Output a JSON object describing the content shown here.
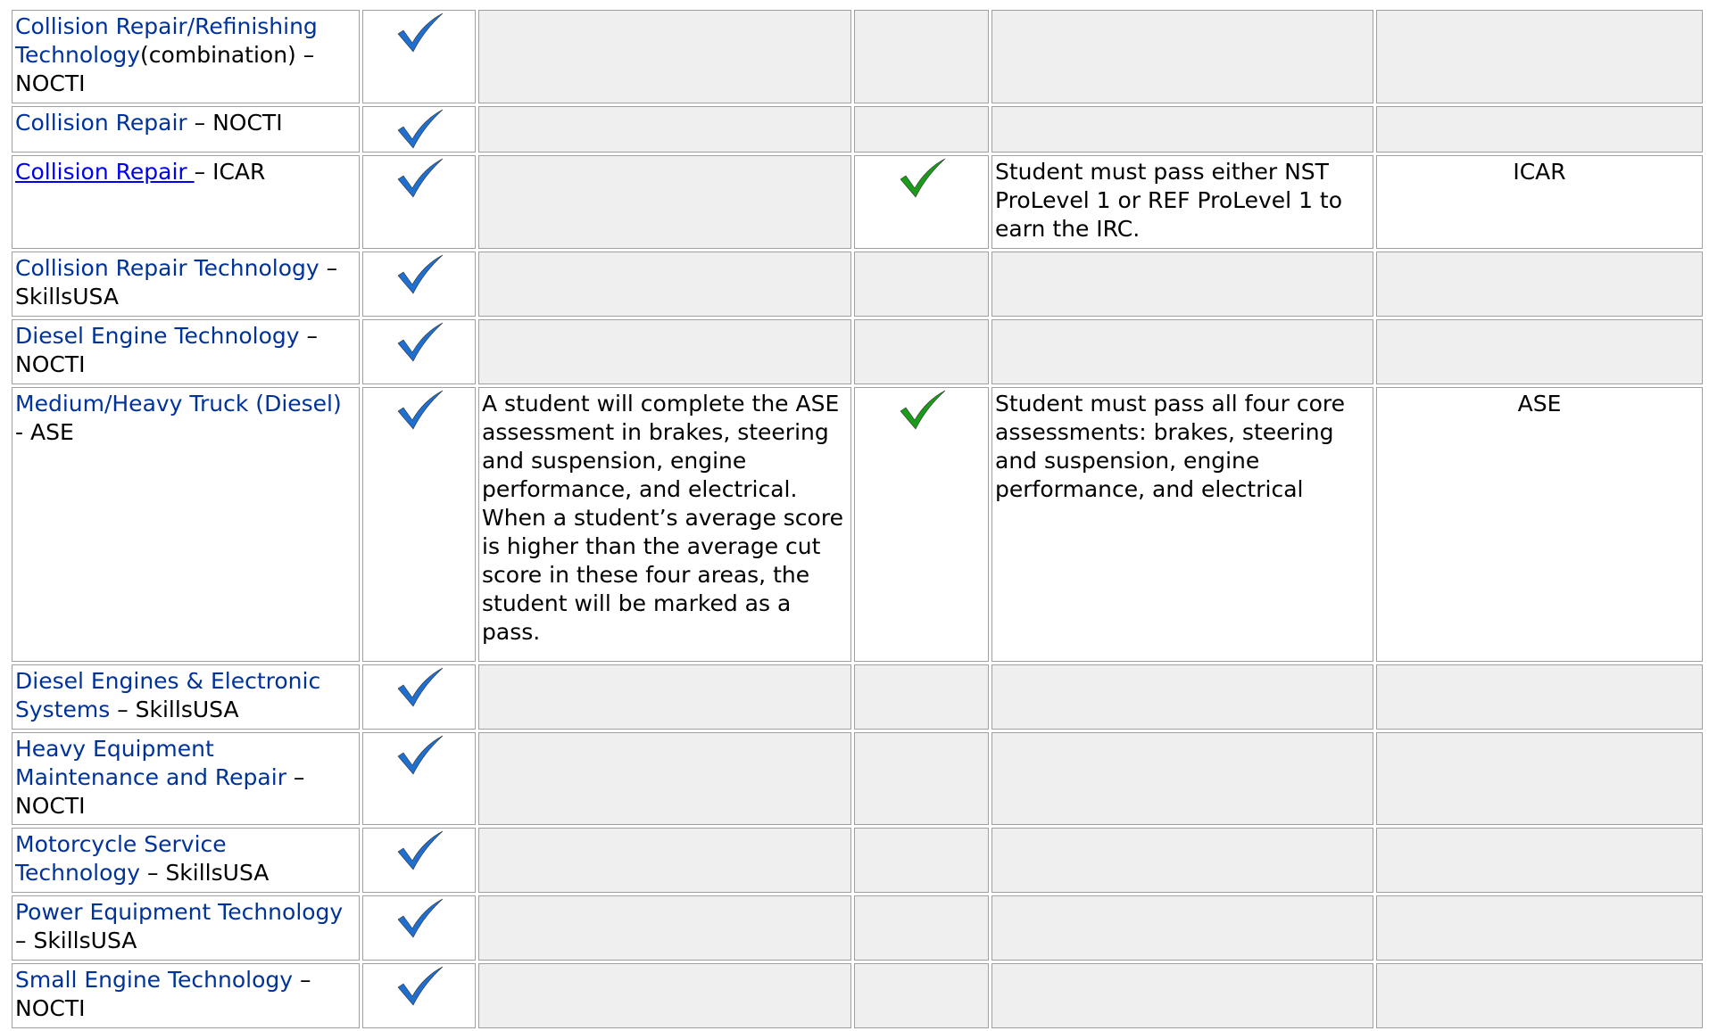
{
  "colors": {
    "blue_check": "#1f6fd1",
    "green_check": "#1a9b1a",
    "empty_cell": "#efefef",
    "link": "#003399"
  },
  "rows": [
    {
      "link": "Collision Repair/Refinishing Technology",
      "suffix": "(combination) – NOCTI",
      "desc": "",
      "note": "",
      "org": "",
      "has_green": false,
      "link_style": "plain"
    },
    {
      "link": "Collision Repair",
      "suffix": " – NOCTI",
      "desc": "",
      "note": "",
      "org": "",
      "has_green": false,
      "link_style": "plain"
    },
    {
      "link": "Collision Repair ",
      "suffix": "– ICAR",
      "desc": "",
      "note": "Student must pass either NST ProLevel 1 or REF ProLevel 1 to earn the IRC.",
      "org": "ICAR",
      "has_green": true,
      "link_style": "underline"
    },
    {
      "link": "Collision Repair Technology",
      "suffix": " – SkillsUSA",
      "desc": "",
      "note": "",
      "org": "",
      "has_green": false,
      "link_style": "plain"
    },
    {
      "link": "Diesel Engine Technology",
      "suffix": " – NOCTI",
      "desc": "",
      "note": "",
      "org": "",
      "has_green": false,
      "link_style": "plain"
    },
    {
      "link": "Medium/Heavy Truck (Diesel)",
      "suffix": " - ASE",
      "desc": "A student will complete the ASE assessment in brakes, steering and suspension, engine performance, and electrical. When a student’s average score is higher than the average cut score in these four areas, the student will be marked as a pass.",
      "note": "Student must pass all four core assessments:  brakes, steering and suspension, engine performance, and electrical",
      "org": "ASE",
      "has_green": true,
      "link_style": "plain"
    },
    {
      "link": "Diesel Engines & Electronic Systems",
      "suffix": " – SkillsUSA",
      "desc": "",
      "note": "",
      "org": "",
      "has_green": false,
      "link_style": "plain"
    },
    {
      "link": "Heavy Equipment Maintenance and Repair",
      "suffix": " – NOCTI",
      "desc": "",
      "note": "",
      "org": "",
      "has_green": false,
      "link_style": "plain"
    },
    {
      "link": "Motorcycle Service Technology",
      "suffix": " – SkillsUSA",
      "desc": "",
      "note": "",
      "org": "",
      "has_green": false,
      "link_style": "plain"
    },
    {
      "link": "Power Equipment Technology",
      "suffix": " – SkillsUSA",
      "desc": "",
      "note": "",
      "org": "",
      "has_green": false,
      "link_style": "plain"
    },
    {
      "link": "Small Engine Technology",
      "suffix": " – NOCTI",
      "desc": "",
      "note": "",
      "org": "",
      "has_green": false,
      "link_style": "plain"
    }
  ]
}
